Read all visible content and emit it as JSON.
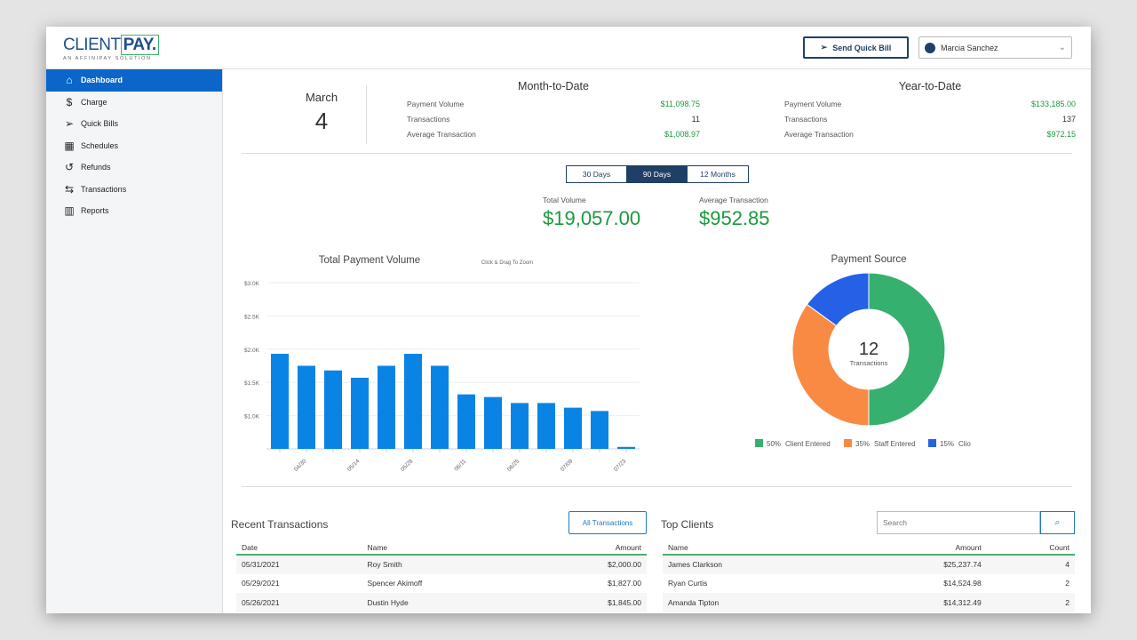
{
  "brand": {
    "name_light": "CLIENT",
    "name_bold": "PAY.",
    "tagline": "AN AFFINIPAY SOLUTION"
  },
  "header": {
    "send_quick_bill": "Send Quick Bill",
    "user": "Marcia Sanchez"
  },
  "sidebar": {
    "items": [
      {
        "label": "Dashboard",
        "icon": "home-icon",
        "active": true
      },
      {
        "label": "Charge",
        "icon": "dollar-circle-icon"
      },
      {
        "label": "Quick Bills",
        "icon": "paper-plane-icon"
      },
      {
        "label": "Schedules",
        "icon": "calendar-icon"
      },
      {
        "label": "Refunds",
        "icon": "undo-icon"
      },
      {
        "label": "Transactions",
        "icon": "arrows-exchange-icon"
      },
      {
        "label": "Reports",
        "icon": "bar-chart-icon"
      }
    ]
  },
  "date": {
    "month": "March",
    "day": "4"
  },
  "mtd": {
    "title": "Month-to-Date",
    "rows": [
      {
        "label": "Payment Volume",
        "value": "$11,098.75"
      },
      {
        "label": "Transactions",
        "value": "11"
      },
      {
        "label": "Average Transaction",
        "value": "$1,008.97"
      }
    ]
  },
  "ytd": {
    "title": "Year-to-Date",
    "rows": [
      {
        "label": "Payment Volume",
        "value": "$133,185.00"
      },
      {
        "label": "Transactions",
        "value": "137"
      },
      {
        "label": "Average Transaction",
        "value": "$972.15"
      }
    ]
  },
  "range_tabs": [
    {
      "label": "30 Days"
    },
    {
      "label": "90 Days",
      "active": true
    },
    {
      "label": "12 Months"
    }
  ],
  "summary": {
    "total_label": "Total Volume",
    "total": "$19,057.00",
    "avg_label": "Average Transaction",
    "avg": "$952.85"
  },
  "colors": {
    "accent": "#0a66c8",
    "green": "#1a9a3c",
    "navy": "#1f3f66",
    "bar": "#0a84e4"
  },
  "chart_data": [
    {
      "type": "bar",
      "title": "Total Payment Volume",
      "hint": "Click & Drag To Zoom",
      "ylim": [
        500,
        3000
      ],
      "yticks": [
        "$1.0K",
        "$1.5K",
        "$2.0K",
        "$2.5K",
        "$3.0K"
      ],
      "ytick_values": [
        1000,
        1500,
        2000,
        2500,
        3000
      ],
      "xticks": [
        "04/30",
        "05/14",
        "05/28",
        "06/11",
        "06/25",
        "07/09",
        "07/23"
      ],
      "values": [
        1930,
        1750,
        1680,
        1570,
        1750,
        1930,
        1750,
        1320,
        1280,
        1190,
        1190,
        1120,
        1070,
        530
      ],
      "color": "#0a84e4",
      "grid": true
    },
    {
      "type": "pie",
      "title": "Payment Source",
      "center_value": "12",
      "center_label": "Transactions",
      "slices": [
        {
          "name": "Client Entered",
          "pct": 50,
          "label": "50%",
          "color": "#35b06f"
        },
        {
          "name": "Staff Entered",
          "pct": 35,
          "label": "35%",
          "color": "#f98a44"
        },
        {
          "name": "Clio",
          "pct": 15,
          "label": "15%",
          "color": "#2461e6"
        }
      ],
      "legend": "bottom"
    }
  ],
  "recent": {
    "title": "Recent Transactions",
    "button": "All Transactions",
    "columns": [
      "Date",
      "Name",
      "Amount"
    ],
    "rows": [
      [
        "05/31/2021",
        "Roy Smith",
        "$2,000.00"
      ],
      [
        "05/29/2021",
        "Spencer Akimoff",
        "$1,827.00"
      ],
      [
        "05/26/2021",
        "Dustin Hyde",
        "$1,845.00"
      ]
    ]
  },
  "top": {
    "title": "Top Clients",
    "search_placeholder": "Search",
    "columns": [
      "Name",
      "Amount",
      "Count"
    ],
    "rows": [
      [
        "James Clarkson",
        "$25,237.74",
        "4"
      ],
      [
        "Ryan Curtis",
        "$14,524.98",
        "2"
      ],
      [
        "Amanda Tipton",
        "$14,312.49",
        "2"
      ]
    ]
  }
}
